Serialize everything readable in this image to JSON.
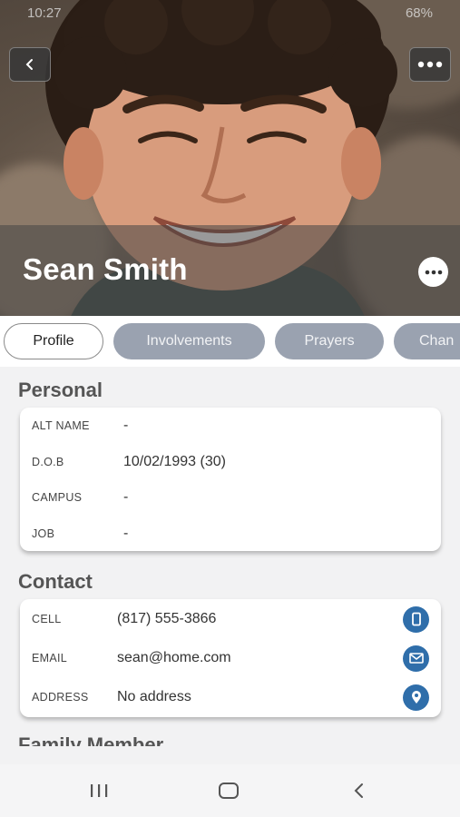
{
  "status_bar": {
    "time": "10:27",
    "battery": "68%"
  },
  "header": {
    "back_icon": "chevron-left-icon",
    "more_icon": "ellipsis-icon"
  },
  "profile": {
    "name": "Sean Smith",
    "photo_icon": "profile-photo"
  },
  "tabs": [
    {
      "label": "Profile",
      "active": true
    },
    {
      "label": "Involvements",
      "active": false
    },
    {
      "label": "Prayers",
      "active": false
    },
    {
      "label": "Chan",
      "active": false
    }
  ],
  "personal": {
    "title": "Personal",
    "rows": [
      {
        "label": "ALT NAME",
        "value": "-"
      },
      {
        "label": "D.O.B",
        "value": "10/02/1993 (30)"
      },
      {
        "label": "CAMPUS",
        "value": "-"
      },
      {
        "label": "JOB",
        "value": "-"
      }
    ]
  },
  "contact": {
    "title": "Contact",
    "rows": [
      {
        "label": "CELL",
        "value": "(817) 555-3866",
        "icon": "phone-icon"
      },
      {
        "label": "EMAIL",
        "value": "sean@home.com",
        "icon": "mail-icon"
      },
      {
        "label": "ADDRESS",
        "value": "No address",
        "icon": "location-icon"
      }
    ]
  },
  "next_section": {
    "title": "Family Member"
  },
  "colors": {
    "accent": "#2f6eaa",
    "tab_inactive": "#9aa2b0",
    "background": "#f2f2f3"
  }
}
